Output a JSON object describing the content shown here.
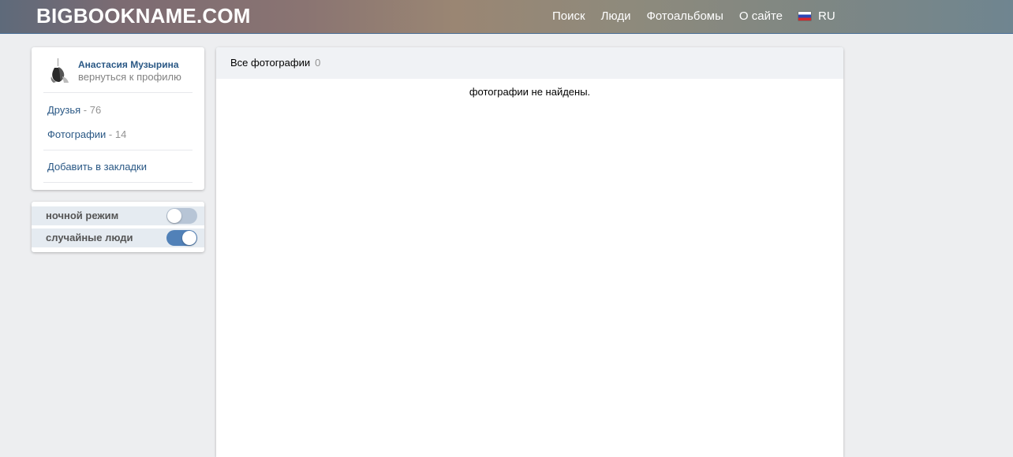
{
  "header": {
    "logo": "BIGBOOKNAME.COM",
    "nav": [
      {
        "label": "Поиск"
      },
      {
        "label": "Люди"
      },
      {
        "label": "Фотоальбомы"
      },
      {
        "label": "О сайте"
      }
    ],
    "language": {
      "label": "RU",
      "flag_icon": "russia-flag-icon"
    }
  },
  "profile": {
    "name": "Анастасия Музырина",
    "back_link": "вернуться к профилю",
    "menu": {
      "friends_label": "Друзья",
      "friends_count": "- 76",
      "photos_label": "Фотографии",
      "photos_count": "- 14",
      "bookmark_label": "Добавить в закладки"
    }
  },
  "settings": {
    "night_mode": {
      "label": "ночной режим",
      "enabled": false
    },
    "random_people": {
      "label": "случайные люди",
      "enabled": true
    }
  },
  "photos": {
    "tab_label": "Все фотографии",
    "tab_count": "0",
    "empty_message": "фотографии не найдены."
  },
  "colors": {
    "link": "#2a5885",
    "toggle_on": "#5181b8",
    "toggle_off": "#b7c5d6",
    "page_bg": "#edeef0"
  }
}
